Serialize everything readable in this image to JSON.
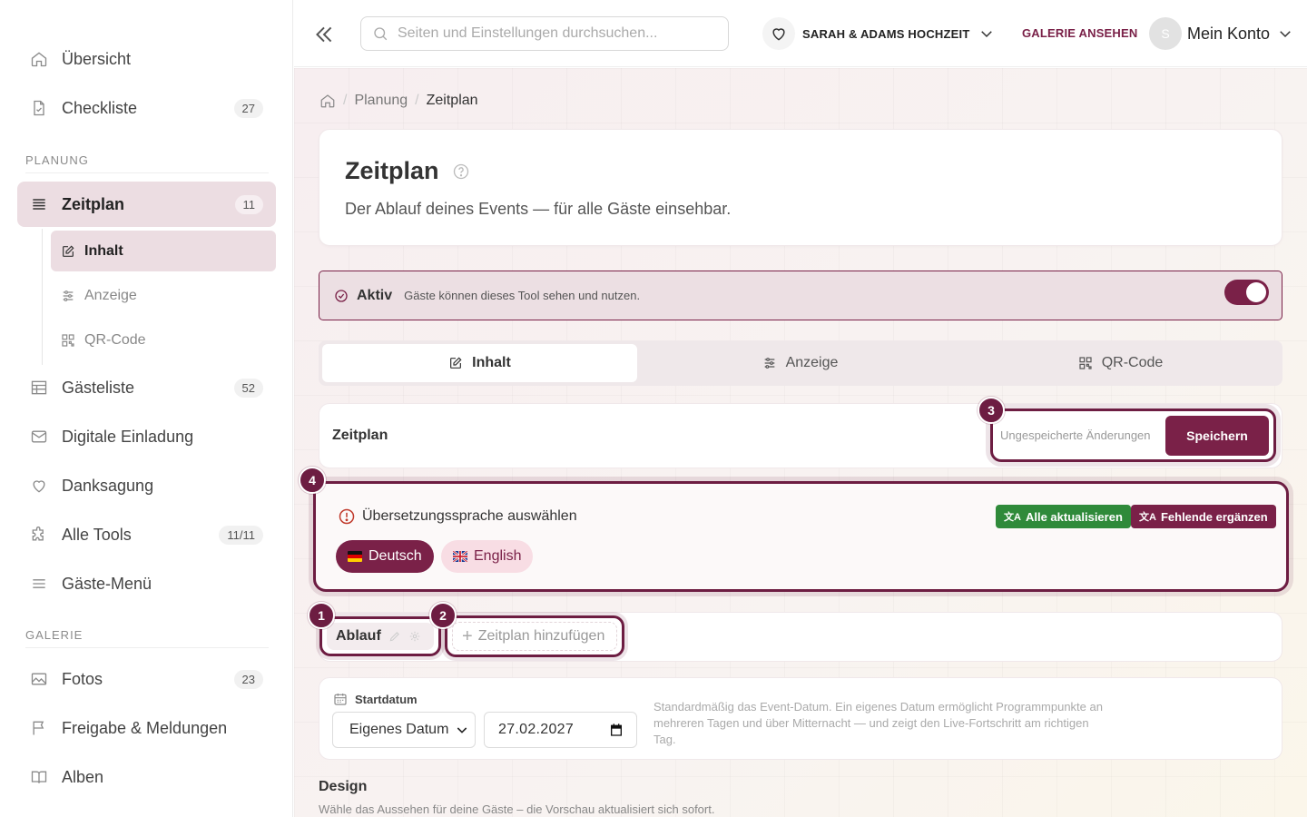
{
  "sidebar": {
    "items": [
      {
        "label": "Übersicht",
        "icon": "home-icon"
      },
      {
        "label": "Checkliste",
        "icon": "checklist-icon",
        "count": "27"
      },
      {
        "label": "Zeitplan",
        "icon": "timeline-icon",
        "count": "11"
      },
      {
        "label": "Gästeliste",
        "icon": "table-icon",
        "count": "52"
      },
      {
        "label": "Digitale Einladung",
        "icon": "mail-icon"
      },
      {
        "label": "Danksagung",
        "icon": "heart-icon"
      },
      {
        "label": "Alle Tools",
        "icon": "puzzle-icon",
        "count": "11/11"
      },
      {
        "label": "Gäste-Menü",
        "icon": "menu-icon"
      },
      {
        "label": "Fotos",
        "icon": "image-icon",
        "count": "23"
      },
      {
        "label": "Freigabe & Meldungen",
        "icon": "flag-icon"
      },
      {
        "label": "Alben",
        "icon": "book-icon"
      }
    ],
    "subitems": [
      {
        "label": "Inhalt",
        "icon": "edit-icon"
      },
      {
        "label": "Anzeige",
        "icon": "sliders-icon"
      },
      {
        "label": "QR-Code",
        "icon": "qr-icon"
      }
    ],
    "sections": {
      "planung": "PLANUNG",
      "galerie": "GALERIE"
    }
  },
  "header": {
    "search_placeholder": "Seiten und Einstellungen durchsuchen...",
    "event_name": "SARAH & ADAMS HOCHZEIT",
    "gallery_link": "GALERIE ANSEHEN",
    "avatar_letter": "S",
    "account_label": "Mein Konto"
  },
  "breadcrumb": {
    "items": [
      "Planung",
      "Zeitplan"
    ]
  },
  "page": {
    "title": "Zeitplan",
    "description": "Der Ablauf deines Events — für alle Gäste einsehbar."
  },
  "status": {
    "label": "Aktiv",
    "description": "Gäste können dieses Tool sehen und nutzen.",
    "enabled": true
  },
  "tabs": [
    {
      "label": "Inhalt",
      "icon": "edit-icon",
      "active": true
    },
    {
      "label": "Anzeige",
      "icon": "sliders-icon",
      "active": false
    },
    {
      "label": "QR-Code",
      "icon": "qr-icon",
      "active": false
    }
  ],
  "editor": {
    "section_title": "Zeitplan",
    "unsaved_text": "Ungespeicherte Änderungen",
    "save_label": "Speichern"
  },
  "translation": {
    "title": "Übersetzungssprache auswählen",
    "update_all": "Alle aktualisieren",
    "fill_missing": "Fehlende ergänzen",
    "languages": [
      {
        "label": "Deutsch",
        "selected": true
      },
      {
        "label": "English",
        "selected": false
      }
    ]
  },
  "schedule_tabs": {
    "items": [
      "Ablauf"
    ],
    "add_label": "Zeitplan hinzufügen"
  },
  "start_date": {
    "label": "Startdatum",
    "select_value": "Eigenes Datum",
    "date_value": "27.02.2027",
    "hint": "Standardmäßig das Event-Datum. Ein eigenes Datum ermöglicht Programmpunkte an mehreren Tagen und über Mitternacht — und zeigt den Live-Fortschritt am richtigen Tag."
  },
  "design": {
    "title": "Design",
    "description": "Wähle das Aussehen für deine Gäste – die Vorschau aktualisiert sich sofort."
  },
  "callouts": [
    "1",
    "2",
    "3",
    "4"
  ],
  "colors": {
    "accent": "#7a2148",
    "active_bg": "#ecdde2",
    "success": "#2f8a3a"
  }
}
